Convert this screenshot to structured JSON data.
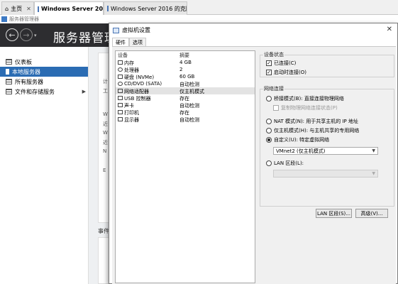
{
  "vmware_tabs": [
    {
      "label": "主页"
    },
    {
      "label": "Windows Server 2016"
    },
    {
      "label": "Windows Server 2016 的克隆..."
    }
  ],
  "server_manager": {
    "window_title": "服务器管理器",
    "heading": "服务器管理器",
    "sidebar": [
      {
        "label": "仪表板"
      },
      {
        "label": "本地服务器"
      },
      {
        "label": "所有服务器"
      },
      {
        "label": "文件和存储服务"
      }
    ],
    "content_letters": [
      "计",
      "工",
      "W",
      "近",
      "W",
      "近",
      "N",
      "E"
    ],
    "events_label": "事件"
  },
  "dialog": {
    "title": "虚拟机设置",
    "tabs": [
      {
        "label": "硬件"
      },
      {
        "label": "选项"
      }
    ],
    "device_columns": {
      "device": "设备",
      "summary": "摘要"
    },
    "devices": [
      {
        "name": "内存",
        "summary": "4 GB",
        "icon": "memory-icon"
      },
      {
        "name": "处理器",
        "summary": "2",
        "icon": "processor-icon"
      },
      {
        "name": "硬盘 (NVMe)",
        "summary": "60 GB",
        "icon": "hard-disk-icon"
      },
      {
        "name": "CD/DVD (SATA)",
        "summary": "自动检测",
        "icon": "cd-dvd-icon"
      },
      {
        "name": "网络适配器",
        "summary": "仅主机模式",
        "icon": "network-adapter-icon"
      },
      {
        "name": "USB 控制器",
        "summary": "存在",
        "icon": "usb-icon"
      },
      {
        "name": "声卡",
        "summary": "自动检测",
        "icon": "sound-card-icon"
      },
      {
        "name": "打印机",
        "summary": "存在",
        "icon": "printer-icon"
      },
      {
        "name": "显示器",
        "summary": "自动检测",
        "icon": "display-icon"
      }
    ],
    "device_status": {
      "title": "设备状态",
      "connected": "已连接(C)",
      "connect_at_power_on": "启动时连接(O)"
    },
    "network_connection": {
      "title": "网络连接",
      "bridged": "桥接模式(B): 直接连接物理网络",
      "replicate_state": "复制物理网络连接状态(P)",
      "nat": "NAT 模式(N): 用于共享主机的 IP 地址",
      "host_only": "仅主机模式(H): 与主机共享的专用网络",
      "custom": "自定义(U): 特定虚拟网络",
      "custom_value": "VMnet2 (仅主机模式)",
      "lan_segment": "LAN 区段(L):",
      "lan_segment_value": ""
    },
    "buttons": {
      "lan_segments": "LAN 区段(S)...",
      "advanced": "高级(V)..."
    }
  }
}
